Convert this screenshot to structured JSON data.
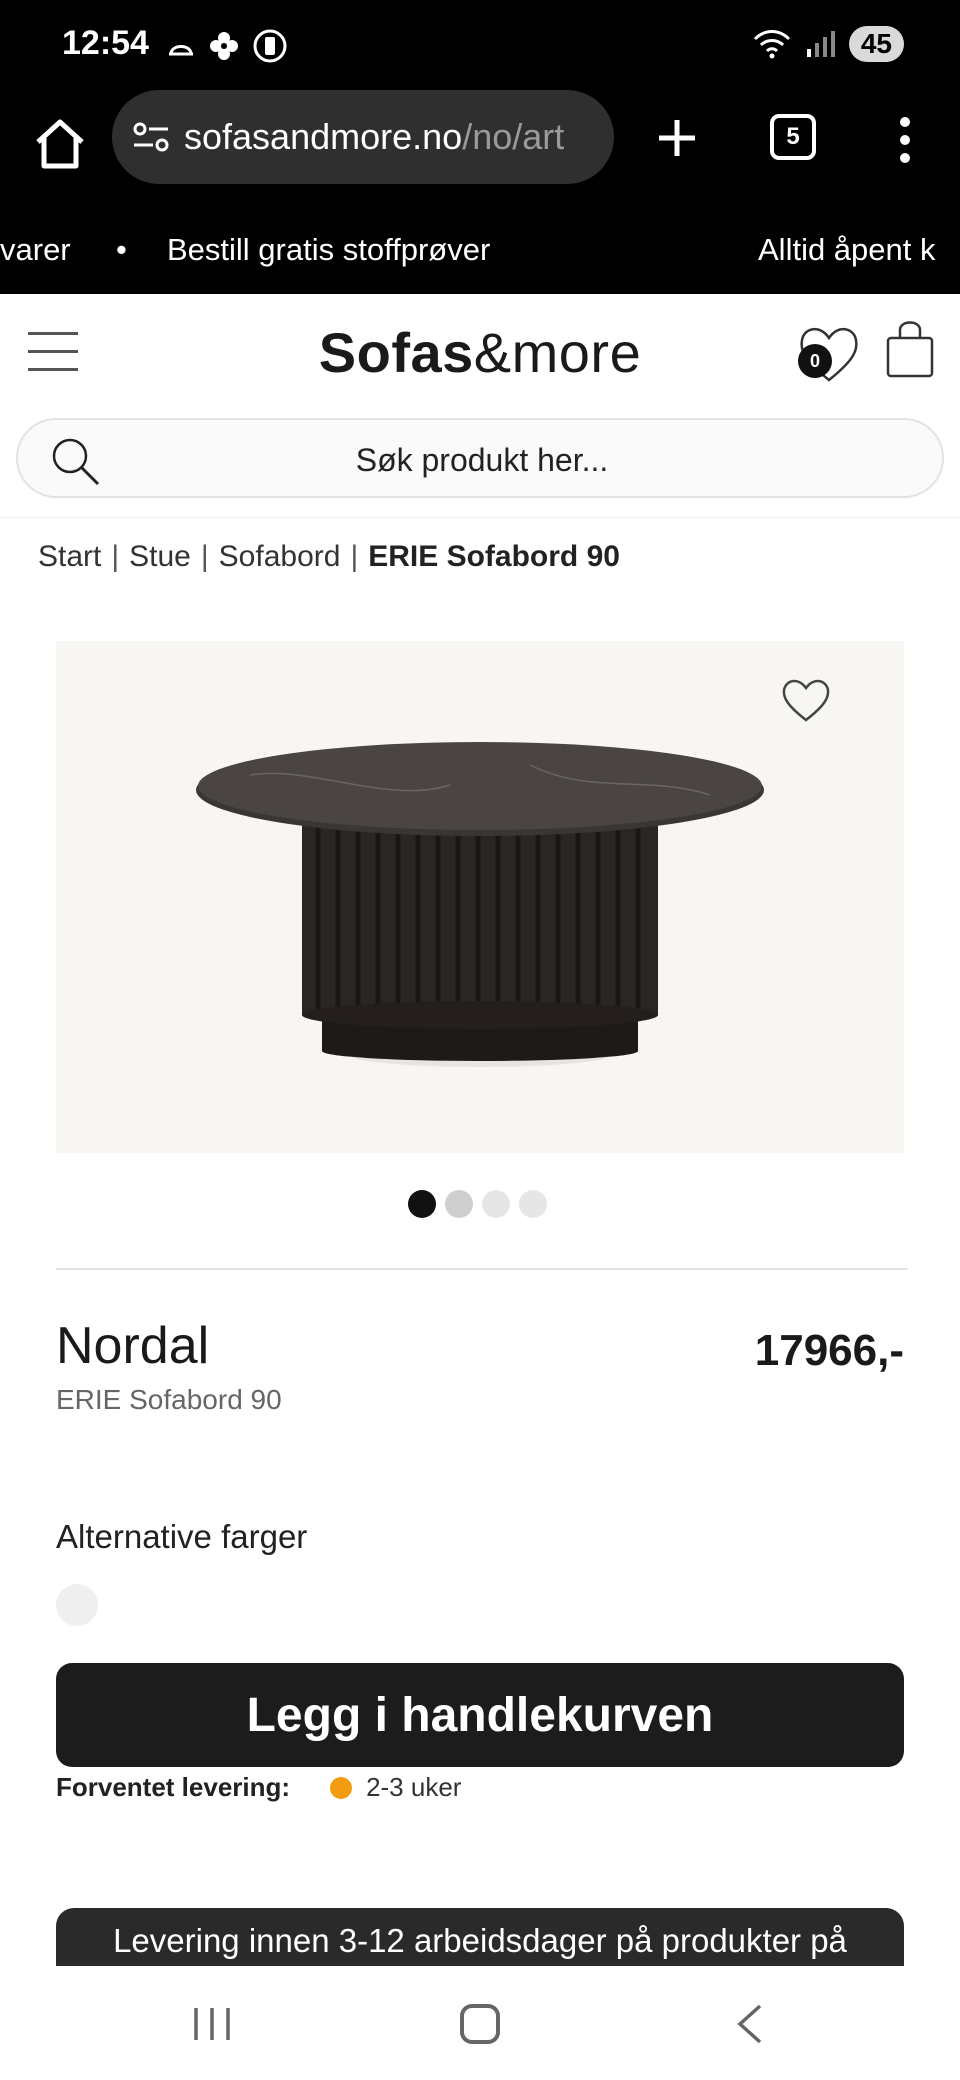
{
  "status_bar": {
    "time": "12:54",
    "battery": "45",
    "icons": [
      "cloud-icon",
      "pinwheel-icon",
      "battery-saver-icon",
      "wifi-icon",
      "signal-icon"
    ]
  },
  "browser": {
    "url_domain": "sofasandmore.no",
    "url_path": "/no/art",
    "tab_count": "5"
  },
  "marquee": {
    "items": [
      "varer",
      "•",
      "Bestill gratis stoffprøver",
      "Alltid åpent k"
    ]
  },
  "header": {
    "logo_bold": "Sofas",
    "logo_rest": "&more",
    "wishlist_count": "0",
    "search_placeholder": "Søk produkt her..."
  },
  "breadcrumb": {
    "items": [
      "Start",
      "Stue",
      "Sofabord"
    ],
    "current": "ERIE Sofabord 90",
    "separator": "|"
  },
  "gallery": {
    "image_count": 4,
    "active_index": 0,
    "dot_colors": [
      "#111111",
      "#cfcfcf",
      "#e6e6e6",
      "#e6e6e6"
    ]
  },
  "product": {
    "brand": "Nordal",
    "name": "ERIE Sofabord 90",
    "price": "17966,-",
    "alt_colors_label": "Alternative farger",
    "swatch_color": "#efefef",
    "add_to_cart_label": "Legg i handlekurven",
    "delivery_label": "Forventet levering:",
    "delivery_value": "2-3 uker",
    "delivery_status_color": "#f39c12"
  },
  "info_banner": {
    "text": "Levering innen 3-12 arbeidsdager på produkter på"
  },
  "colors": {
    "chrome_bg": "#000000",
    "urlbar_bg": "#2f2f2f",
    "button_bg": "#1c1c1c",
    "image_bg": "#f8f6f3"
  }
}
